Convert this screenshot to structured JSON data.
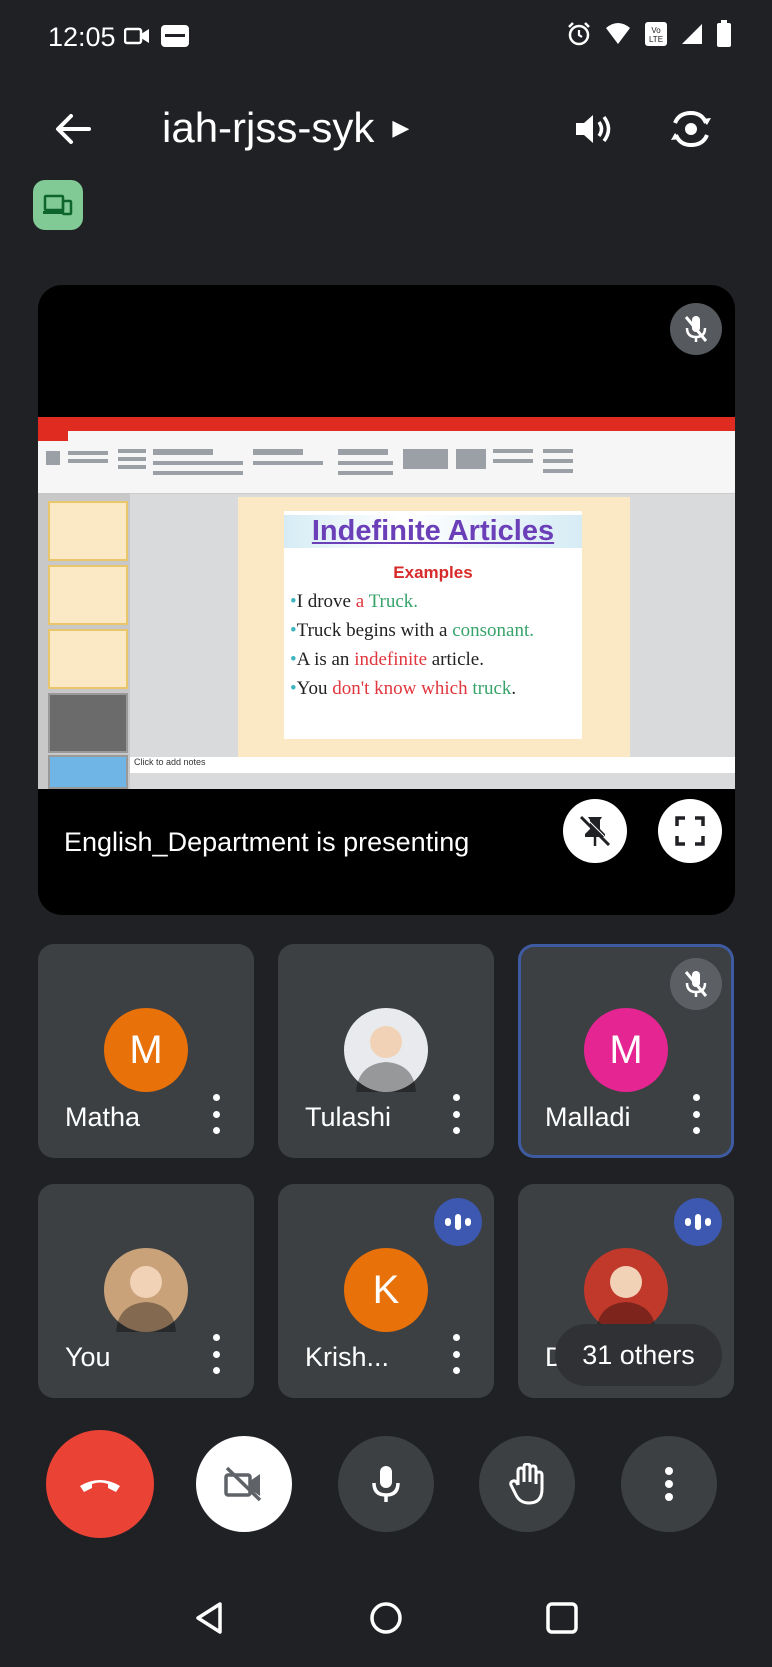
{
  "status_bar": {
    "time": "12:05",
    "left_icons": [
      "video-camera-icon",
      "notification-icon"
    ],
    "right_icons": [
      "alarm-icon",
      "wifi-icon",
      "volte-icon",
      "signal-icon",
      "battery-icon"
    ]
  },
  "header": {
    "meeting_code": "iah-rjss-syk",
    "back_icon": "arrow-left-icon",
    "speaker_icon": "speaker-icon",
    "switch_camera_icon": "switch-camera-icon",
    "device_badge_icon": "companion-device-icon"
  },
  "presentation": {
    "presenter_text": "English_Department is presenting",
    "slide": {
      "title": "Indefinite Articles",
      "subtitle": "Examples",
      "lines": [
        {
          "parts": [
            {
              "t": "I drove ",
              "c": ""
            },
            {
              "t": "a ",
              "c": "r"
            },
            {
              "t": "Truck.",
              "c": "g"
            }
          ]
        },
        {
          "parts": [
            {
              "t": "Truck begins with a ",
              "c": ""
            },
            {
              "t": "consonant.",
              "c": "g"
            }
          ]
        },
        {
          "parts": [
            {
              "t": "A is an ",
              "c": ""
            },
            {
              "t": "indefinite",
              "c": "r"
            },
            {
              "t": " article.",
              "c": ""
            }
          ]
        },
        {
          "parts": [
            {
              "t": "You ",
              "c": ""
            },
            {
              "t": "don't know which ",
              "c": "r"
            },
            {
              "t": "truck",
              "c": "g"
            },
            {
              "t": ".",
              "c": ""
            }
          ]
        }
      ],
      "notes_placeholder": "Click to add notes"
    }
  },
  "participants": [
    {
      "name": "Matha",
      "initial": "M",
      "avatar_color": "#e8710a",
      "photo": false,
      "muted": false,
      "speaking": false,
      "active": false
    },
    {
      "name": "Tulashi",
      "initial": "",
      "avatar_color": "#e8eaed",
      "photo": true,
      "muted": false,
      "speaking": false,
      "active": false
    },
    {
      "name": "Malladi",
      "initial": "M",
      "avatar_color": "#e52592",
      "photo": false,
      "muted": true,
      "speaking": false,
      "active": true
    },
    {
      "name": "You",
      "initial": "",
      "avatar_color": "#c9a27a",
      "photo": true,
      "muted": false,
      "speaking": false,
      "active": false
    },
    {
      "name": "Krish...",
      "initial": "K",
      "avatar_color": "#e8710a",
      "photo": false,
      "muted": false,
      "speaking": true,
      "active": false
    },
    {
      "name": "D.",
      "initial": "",
      "avatar_color": "#c0392b",
      "photo": true,
      "muted": false,
      "speaking": true,
      "active": false
    }
  ],
  "others_count_label": "31 others",
  "controls": {
    "end_call_icon": "phone-hangup-icon",
    "camera_icon": "camera-off-icon",
    "mic_icon": "microphone-icon",
    "raise_hand_icon": "hand-icon",
    "more_icon": "more-vert-icon"
  },
  "colors": {
    "end_call": "#ea4335",
    "tile_bg": "#3c4043",
    "speaking_indicator": "#3c58b0"
  }
}
